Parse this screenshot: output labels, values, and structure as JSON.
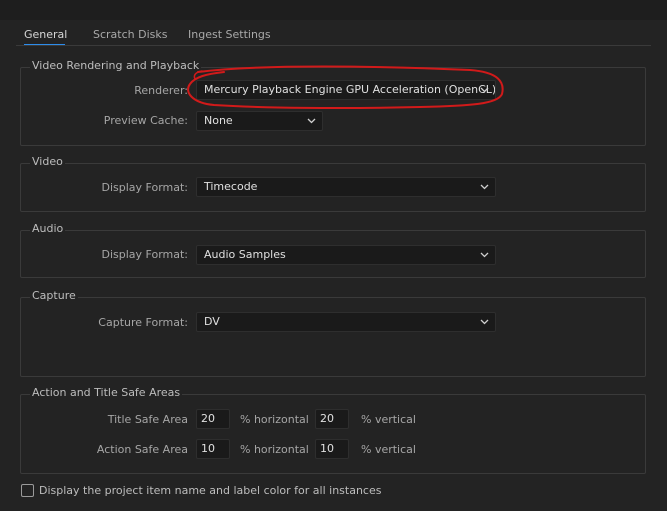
{
  "tabs": [
    {
      "label": "General",
      "active": true
    },
    {
      "label": "Scratch Disks",
      "active": false
    },
    {
      "label": "Ingest Settings",
      "active": false
    }
  ],
  "video_rendering": {
    "title": "Video Rendering and Playback",
    "renderer_label": "Renderer:",
    "renderer_value": "Mercury Playback Engine GPU Acceleration (OpenCL)",
    "preview_cache_label": "Preview Cache:",
    "preview_cache_value": "None"
  },
  "video": {
    "title": "Video",
    "display_format_label": "Display Format:",
    "display_format_value": "Timecode"
  },
  "audio": {
    "title": "Audio",
    "display_format_label": "Display Format:",
    "display_format_value": "Audio Samples"
  },
  "capture": {
    "title": "Capture",
    "capture_format_label": "Capture Format:",
    "capture_format_value": "DV"
  },
  "safe_areas": {
    "title": "Action and Title Safe Areas",
    "title_safe": {
      "label": "Title Safe Area",
      "horizontal": "20",
      "horizontal_unit": "% horizontal",
      "vertical": "20",
      "vertical_unit": "% vertical"
    },
    "action_safe": {
      "label": "Action Safe Area",
      "horizontal": "10",
      "horizontal_unit": "% horizontal",
      "vertical": "10",
      "vertical_unit": "% vertical"
    }
  },
  "checkbox": {
    "label": "Display the project item name and label color for all instances",
    "checked": false
  },
  "colors": {
    "background": "#232323",
    "accent": "#2d8ceb",
    "annotation": "#d11a1a"
  }
}
